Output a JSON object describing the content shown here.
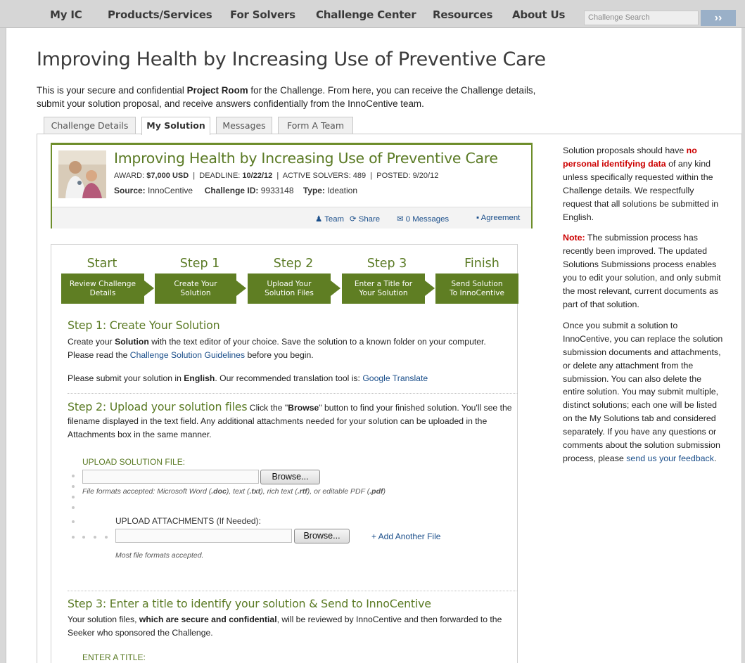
{
  "nav": {
    "items": [
      "My IC",
      "Products/Services",
      "For Solvers",
      "Challenge Center",
      "Resources",
      "About Us"
    ],
    "search_placeholder": "Challenge Search",
    "search_go": "››"
  },
  "page": {
    "title": "Improving Health by Increasing Use of Preventive Care",
    "intro_pre": "This is your secure and confidential ",
    "intro_bold": "Project Room",
    "intro_post": " for the Challenge. From here, you can receive the Challenge details, submit your solution proposal, and receive answers confidentially from the InnoCentive team."
  },
  "tabs": [
    "Challenge Details",
    "My Solution",
    "Messages",
    "Form A Team"
  ],
  "summary": {
    "title": "Improving Health by Increasing Use of Preventive Care",
    "award_label": "AWARD:",
    "award_value": "$7,000 USD",
    "deadline_label": "DEADLINE:",
    "deadline_value": "10/22/12",
    "solvers_label": "ACTIVE SOLVERS:",
    "solvers_value": "489",
    "posted_label": "POSTED:",
    "posted_value": "9/20/12",
    "source_label": "Source:",
    "source_value": "InnoCentive",
    "id_label": "Challenge ID:",
    "id_value": "9933148",
    "type_label": "Type:",
    "type_value": "Ideation",
    "team": "Team",
    "share": "Share",
    "messages": "0 Messages",
    "agreement": "Agreement"
  },
  "steps": [
    {
      "head": "Start",
      "box1": "Review Challenge",
      "box2": "Details"
    },
    {
      "head": "Step 1",
      "box1": "Create Your",
      "box2": "Solution"
    },
    {
      "head": "Step 2",
      "box1": "Upload Your",
      "box2": "Solution Files"
    },
    {
      "head": "Step 3",
      "box1": "Enter a Title for",
      "box2": "Your Solution"
    },
    {
      "head": "Finish",
      "box1": "Send Solution",
      "box2": "To InnoCentive"
    }
  ],
  "step1": {
    "title": "Step 1: Create Your Solution",
    "p1_a": "Create your ",
    "p1_b": "Solution",
    "p1_c": " with the text editor of your choice. Save the solution to a known folder on your computer. Please read the ",
    "p1_link": "Challenge Solution Guidelines",
    "p1_d": " before you begin.",
    "p2_a": "Please submit your solution in ",
    "p2_b": "English",
    "p2_c": ". Our recommended translation tool is: ",
    "p2_link": "Google Translate"
  },
  "step2": {
    "title": "Step 2: Upload your solution files",
    "text_a": " Click the \"",
    "text_b": "Browse",
    "text_c": "\" button to find your finished solution. You'll see the filename displayed in the text field. Any additional attachments needed for your solution can be uploaded in the Attachments box in the same manner.",
    "upload_label": "UPLOAD SOLUTION FILE:",
    "browse": "Browse...",
    "formats_a": "File formats accepted: Microsoft Word (",
    "formats_doc": ".doc",
    "formats_b": "), text (",
    "formats_txt": ".txt",
    "formats_c": "), rich text (",
    "formats_rtf": ".rtf",
    "formats_d": "), or editable PDF (",
    "formats_pdf": ".pdf",
    "formats_e": ")",
    "attach_label": "UPLOAD ATTACHMENTS (If Needed):",
    "add_file": "+ Add Another File",
    "attach_hint": "Most file formats accepted."
  },
  "step3": {
    "title": "Step 3: Enter a title to identify your solution & Send to InnoCentive",
    "text_a": "Your solution files, ",
    "text_b": "which are secure and confidential",
    "text_c": ", will be reviewed by InnoCentive and then forwarded to the Seeker who sponsored the Challenge.",
    "title_label": "ENTER A TITLE:"
  },
  "sidebar": {
    "p1_a": "Solution proposals should have ",
    "p1_red": "no personal identifying data",
    "p1_b": " of any kind unless specifically requested within the Challenge details. We respectfully request that all solutions be submitted in English.",
    "p2_red": "Note:",
    "p2_b": " The submission process has recently been improved. The updated Solutions Submissions process enables you to edit your solution, and only submit the most relevant, current documents as part of that solution.",
    "p3_a": "Once you submit a solution to InnoCentive, you can replace the solution submission documents and attachments, or delete any attachment from the submission. You can also delete the entire solution. You may submit multiple, distinct solutions; each one will be listed on the My Solutions tab and considered separately. If you have any questions or comments about the solution submission process, please ",
    "p3_link": "send us your feedback",
    "p3_b": "."
  }
}
